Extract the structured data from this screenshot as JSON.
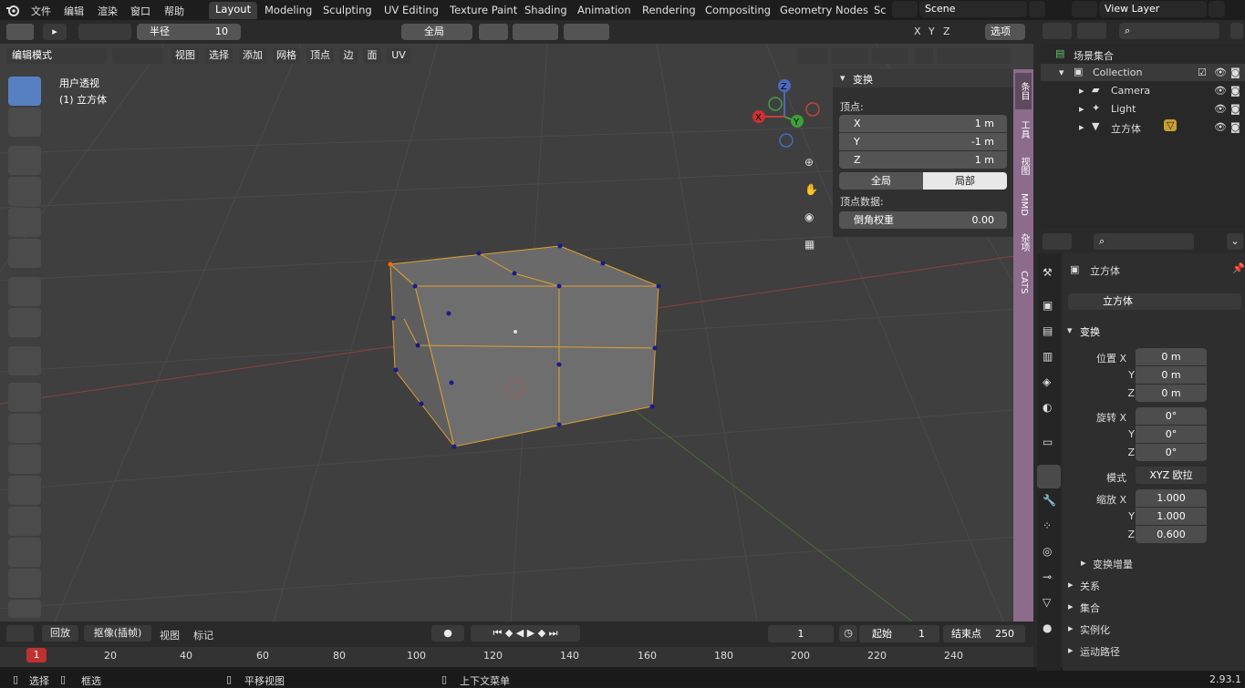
{
  "menu": {
    "file": "文件",
    "edit": "编辑",
    "render": "渲染",
    "window": "窗口",
    "help": "帮助"
  },
  "workspaces": [
    "Layout",
    "Modeling",
    "Sculpting",
    "UV Editing",
    "Texture Paint",
    "Shading",
    "Animation",
    "Rendering",
    "Compositing",
    "Geometry Nodes",
    "Sc"
  ],
  "scene": {
    "name": "Scene",
    "view_layer": "View Layer"
  },
  "header": {
    "radius_label": "半径",
    "radius_value": "10",
    "orientation": "全局",
    "options": "选项",
    "axes": [
      "X",
      "Y",
      "Z"
    ]
  },
  "viewport_header": {
    "mode": "编辑模式",
    "menus": [
      "视图",
      "选择",
      "添加",
      "网格",
      "顶点",
      "边",
      "面",
      "UV"
    ]
  },
  "viewport": {
    "view_name": "用户透视",
    "object_label": "(1) 立方体"
  },
  "npanel": {
    "title": "变换",
    "vertex_label": "顶点:",
    "x_label": "X",
    "x_value": "1 m",
    "y_label": "Y",
    "y_value": "-1 m",
    "z_label": "Z",
    "z_value": "1 m",
    "global": "全局",
    "local": "局部",
    "vertex_data_label": "顶点数据:",
    "bevel_label": "倒角权重",
    "bevel_value": "0.00"
  },
  "side_tabs": [
    "条目",
    "工具",
    "视图",
    "MMD",
    "杂项",
    "CATS"
  ],
  "outliner": {
    "root": "场景集合",
    "collection": "Collection",
    "items": [
      "Camera",
      "Light",
      "立方体"
    ]
  },
  "properties": {
    "object_name": "立方体",
    "object_field": "立方体",
    "transform": "变换",
    "location_label": "位置 X",
    "loc_x": "0 m",
    "loc_y": "0 m",
    "loc_z": "0 m",
    "rotation_label": "旋转 X",
    "rot_x": "0°",
    "rot_y": "0°",
    "rot_z": "0°",
    "mode_label": "模式",
    "mode_value": "XYZ 欧拉",
    "scale_label": "缩放 X",
    "scale_x": "1.000",
    "scale_y": "1.000",
    "scale_z": "0.600",
    "y_label": "Y",
    "z_label": "Z",
    "delta": "变换增量",
    "sections": [
      "关系",
      "集合",
      "实例化",
      "运动路径"
    ]
  },
  "timeline": {
    "playback": "回放",
    "keying": "抠像(插帧)",
    "view": "视图",
    "marker": "标记",
    "current_frame": "1",
    "start_label": "起始",
    "start": "1",
    "end_label": "结束点",
    "end": "250",
    "ticks": [
      "1",
      "20",
      "40",
      "60",
      "80",
      "100",
      "120",
      "140",
      "160",
      "180",
      "200",
      "220",
      "240"
    ]
  },
  "status": {
    "select": "选择",
    "box_select": "框选",
    "pan": "平移视图",
    "context_menu": "上下文菜单",
    "version": "2.93.1"
  }
}
